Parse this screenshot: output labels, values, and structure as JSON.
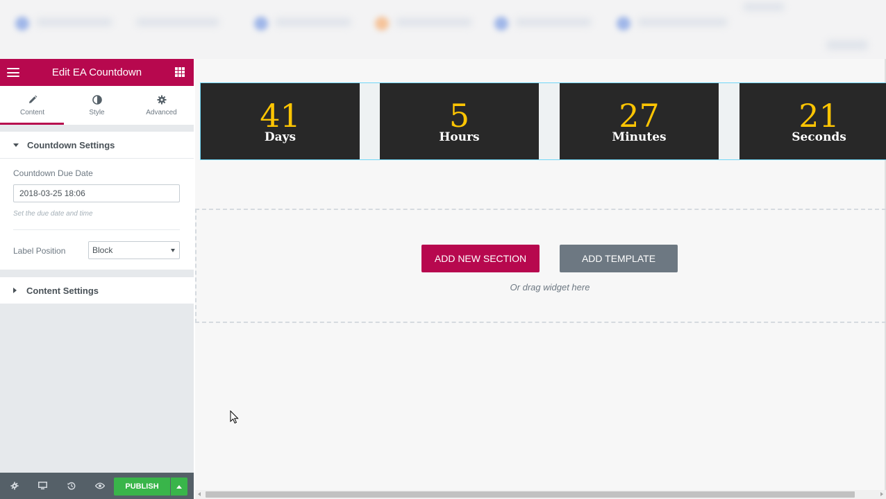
{
  "panel": {
    "title": "Edit EA Countdown",
    "menu_icon": "hamburger-icon",
    "widgets_icon": "grid-icon",
    "tabs": [
      {
        "label": "Content",
        "icon": "pencil-icon",
        "active": true
      },
      {
        "label": "Style",
        "icon": "contrast-icon",
        "active": false
      },
      {
        "label": "Advanced",
        "icon": "gear-icon",
        "active": false
      }
    ],
    "countdown_settings": {
      "heading": "Countdown Settings",
      "due_date_label": "Countdown Due Date",
      "due_date_value": "2018-03-25 18:06",
      "due_date_help": "Set the due date and time",
      "label_position_label": "Label Position",
      "label_position_value": "Block"
    },
    "content_settings": {
      "heading": "Content Settings"
    },
    "footer": {
      "publish_label": "PUBLISH"
    }
  },
  "countdown": [
    {
      "value": "41",
      "label": "Days"
    },
    {
      "value": "5",
      "label": "Hours"
    },
    {
      "value": "27",
      "label": "Minutes"
    },
    {
      "value": "21",
      "label": "Seconds"
    }
  ],
  "drop_zone": {
    "add_section_label": "ADD NEW SECTION",
    "add_template_label": "ADD TEMPLATE",
    "hint": "Or drag widget here"
  },
  "colors": {
    "brand": "#b7084e",
    "countdown_bg": "#282828",
    "countdown_digit": "#fec503",
    "publish": "#39b54a"
  }
}
